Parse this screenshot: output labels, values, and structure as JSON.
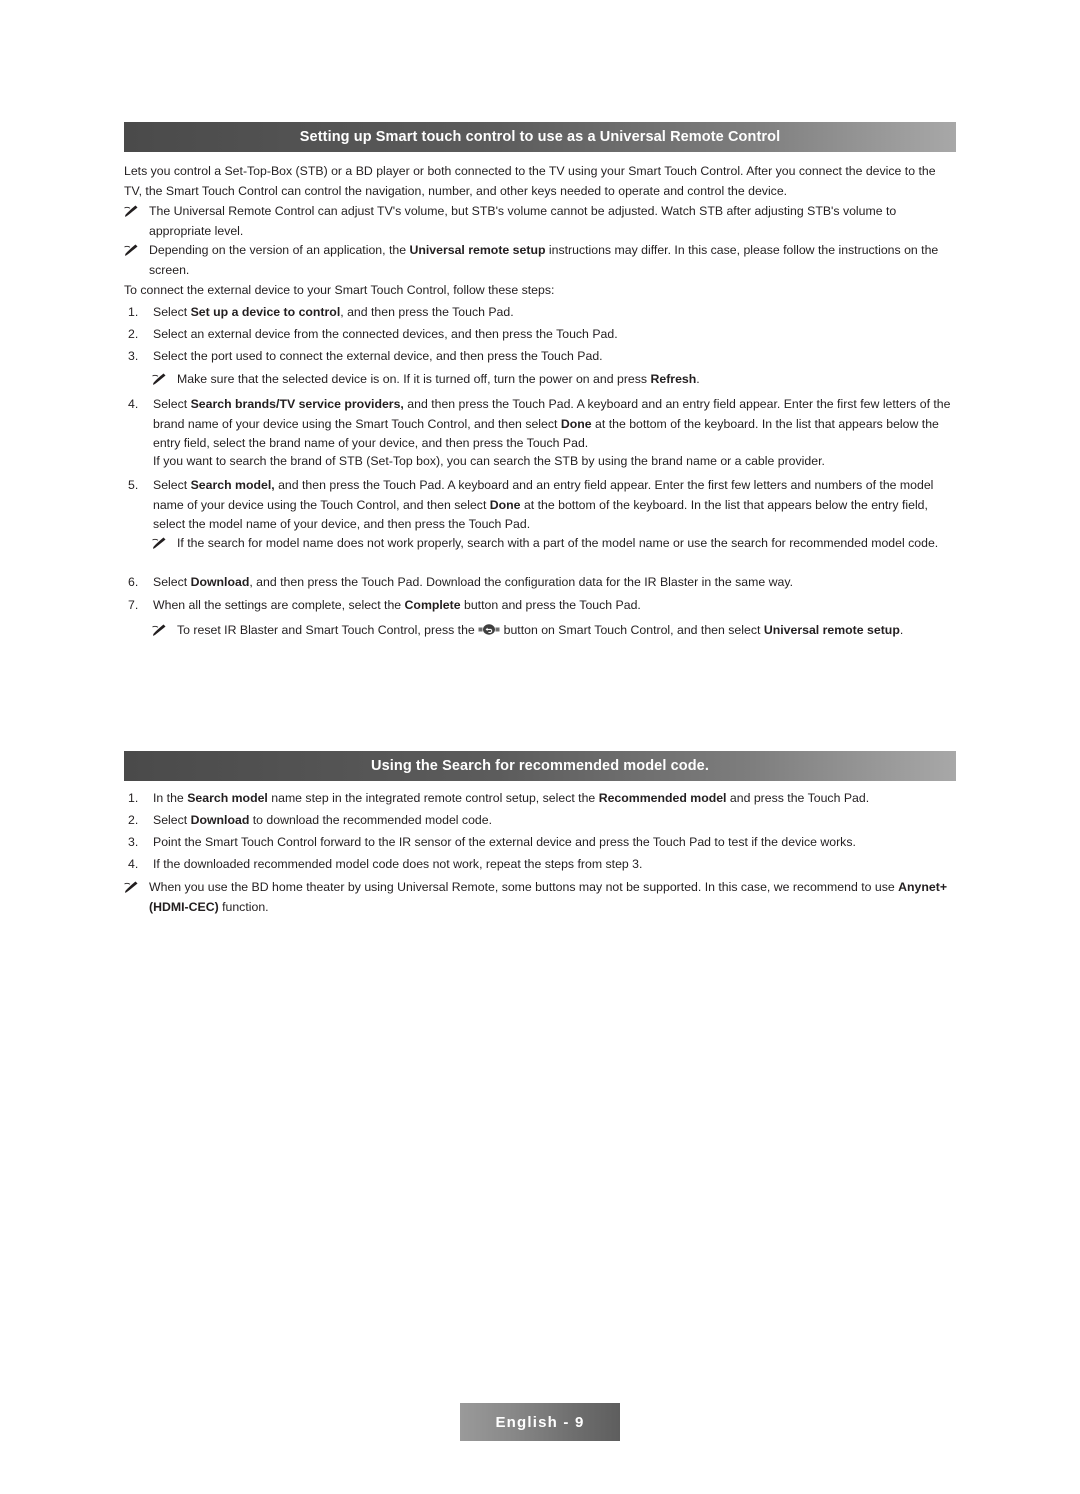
{
  "section1": {
    "title": "Setting up Smart touch control to use as a Universal Remote Control",
    "intro": "Lets you control a Set-Top-Box (STB) or a BD player or both connected to the TV using your Smart Touch Control. After you connect the device to the TV, the Smart Touch Control can control the navigation, number, and other keys needed to operate and control the device.",
    "note1": "The Universal Remote Control can adjust TV's volume, but STB's volume cannot be adjusted. Watch STB after adjusting STB's volume to appropriate level.",
    "note2_a": "Depending on the version of an application, the ",
    "note2_b": "Universal remote setup",
    "note2_c": " instructions may differ. In this case, please follow the instructions on the screen.",
    "lead": "To connect the external device to your Smart Touch Control, follow these steps:",
    "step1_num": "1.",
    "step1_a": "Select ",
    "step1_b": "Set up a device to control",
    "step1_c": ", and then press the Touch Pad.",
    "step2_num": "2.",
    "step2_text": "Select an external device from the connected devices, and then press the Touch Pad.",
    "step3_num": "3.",
    "step3_text": "Select the port used to connect the external device, and then press the Touch Pad.",
    "note3_a": "Make sure that the selected device is on. If it is turned off, turn the power on and press ",
    "note3_b": "Refresh",
    "note3_c": ".",
    "step4_num": "4.",
    "step4_a": "Select ",
    "step4_b": "Search brands/TV service providers,",
    "step4_c": " and then press the Touch Pad. A keyboard and an entry field appear. Enter the first few letters of the brand name of your device using the Smart Touch Control, and then select ",
    "step4_d": "Done",
    "step4_e": " at the bottom of the keyboard. In the list that appears below the entry field, select the brand name of your device, and then press the Touch Pad.",
    "step4_sub": "If you want to search the brand of STB (Set-Top box), you can search the STB by using the brand name or a cable provider.",
    "step5_num": "5.",
    "step5_a": "Select ",
    "step5_b": "Search model,",
    "step5_c": " and then press the Touch Pad. A keyboard and an entry field appear. Enter the first few letters and numbers of the model name of your device using the Touch Control, and then select ",
    "step5_d": "Done",
    "step5_e": " at the bottom of the keyboard. In the list that appears below the entry field, select the model name of your device, and then press the Touch Pad.",
    "note4": "If the search for model name does not work properly, search with a part of the model name or use the search for recommended model code.",
    "step6_num": "6.",
    "step6_a": "Select ",
    "step6_b": "Download",
    "step6_c": ", and then press the Touch Pad. Download the configuration data for the IR Blaster in the same way.",
    "step7_num": "7.",
    "step7_a": "When all the settings are complete, select the ",
    "step7_b": "Complete",
    "step7_c": " button and press the Touch Pad.",
    "note5_a": "To reset IR Blaster and Smart Touch Control, press the ",
    "note5_b": " button on Smart Touch Control, and then select ",
    "note5_c": "Universal remote setup",
    "note5_d": "."
  },
  "section2": {
    "title": "Using the Search for recommended model code.",
    "step1_num": "1.",
    "step1_a": "In the ",
    "step1_b": "Search model",
    "step1_c": " name step in the integrated remote control setup, select the ",
    "step1_d": "Recommended model",
    "step1_e": " and press the Touch Pad.",
    "step2_num": "2.",
    "step2_a": "Select ",
    "step2_b": "Download",
    "step2_c": " to download the recommended model code.",
    "step3_num": "3.",
    "step3_text": "Point the Smart Touch Control forward to the IR sensor of the external device and press the Touch Pad to test if the device works.",
    "step4_num": "4.",
    "step4_text": "If the downloaded recommended model code does not work, repeat the steps from step 3.",
    "note1_a": "When you use the BD home theater by using Universal Remote, some buttons may not be supported. In this case, we recommend to use ",
    "note1_b": "Anynet+ (HDMI-CEC)",
    "note1_c": " function."
  },
  "footer": {
    "label": "English - 9"
  },
  "icons": {
    "note": "pencil-note-icon",
    "remote_button": "remote-return-button-icon"
  },
  "colors": {
    "bar_dark": "#4a4a4a",
    "bar_light": "#a8a8a8",
    "text": "#231f20",
    "footer_text": "#ffffff"
  }
}
